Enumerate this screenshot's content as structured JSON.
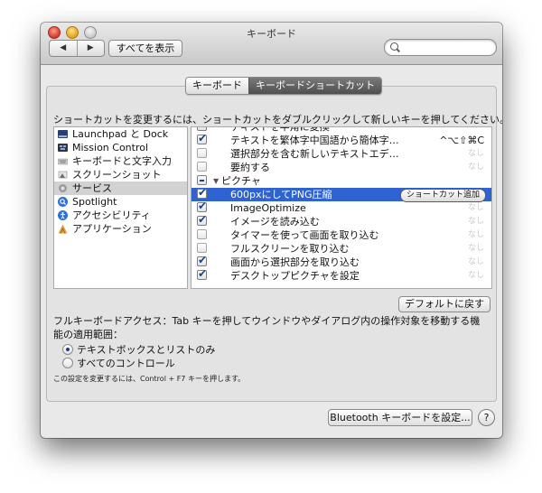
{
  "window": {
    "title": "キーボード",
    "show_all_label": "すべてを表示",
    "search_placeholder": ""
  },
  "tabs": [
    {
      "label": "キーボード",
      "active": false
    },
    {
      "label": "キーボードショートカット",
      "active": true
    }
  ],
  "instruction": "ショートカットを変更するには、ショートカットをダブルクリックして新しいキーを押してください。",
  "categories": [
    {
      "label": "Launchpad と Dock",
      "icon": "launchpad-icon",
      "selected": false
    },
    {
      "label": "Mission Control",
      "icon": "mission-control-icon",
      "selected": false
    },
    {
      "label": "キーボードと文字入力",
      "icon": "keyboard-icon",
      "selected": false
    },
    {
      "label": "スクリーンショット",
      "icon": "screenshot-icon",
      "selected": false
    },
    {
      "label": "サービス",
      "icon": "gear-icon",
      "selected": true
    },
    {
      "label": "Spotlight",
      "icon": "spotlight-icon",
      "selected": false
    },
    {
      "label": "アクセシビリティ",
      "icon": "accessibility-icon",
      "selected": false
    },
    {
      "label": "アプリケーション",
      "icon": "app-icon",
      "selected": false
    }
  ],
  "services": {
    "row0": {
      "label": "テキストを半角に変換",
      "checked": true,
      "shortcut": ""
    },
    "row1": {
      "label": "テキストを繁体字中国語から簡体字…",
      "checked": true,
      "shortcut": "^⌥⇧⌘C"
    },
    "row2": {
      "label": "選択部分を含む新しいテキストエデ…",
      "checked": false,
      "shortcut": "なし"
    },
    "row3": {
      "label": "要約する",
      "checked": false,
      "shortcut": "なし"
    },
    "group": {
      "label": "ピクチャ"
    },
    "row4": {
      "label": "600pxにしてPNG圧縮",
      "checked": true,
      "button": "ショートカット追加"
    },
    "row5": {
      "label": "ImageOptimize",
      "checked": true,
      "shortcut": "なし"
    },
    "row6": {
      "label": "イメージを読み込む",
      "checked": true,
      "shortcut": "なし"
    },
    "row7": {
      "label": "タイマーを使って画面を取り込む",
      "checked": false,
      "shortcut": "なし"
    },
    "row8": {
      "label": "フルスクリーンを取り込む",
      "checked": false,
      "shortcut": "なし"
    },
    "row9": {
      "label": "画面から選択部分を取り込む",
      "checked": true,
      "shortcut": "なし"
    },
    "row10": {
      "label": "デスクトップピクチャを設定",
      "checked": true,
      "shortcut": "なし"
    }
  },
  "restore_defaults_label": "デフォルトに戻す",
  "full_keyboard_access": "フルキーボードアクセス：Tab キーを押してウインドウやダイアログ内の操作対象を移動する機能の適用範囲：",
  "radio_options": [
    {
      "label": "テキストボックスとリストのみ",
      "selected": true
    },
    {
      "label": "すべてのコントロール",
      "selected": false
    }
  ],
  "note": "この設定を変更するには、Control + F7 キーを押します。",
  "bluetooth_button_label": "Bluetooth キーボードを設定...",
  "help_label": "?",
  "colors": {
    "selection": "#2f63d1",
    "tab_active": "#5f5f5f"
  }
}
